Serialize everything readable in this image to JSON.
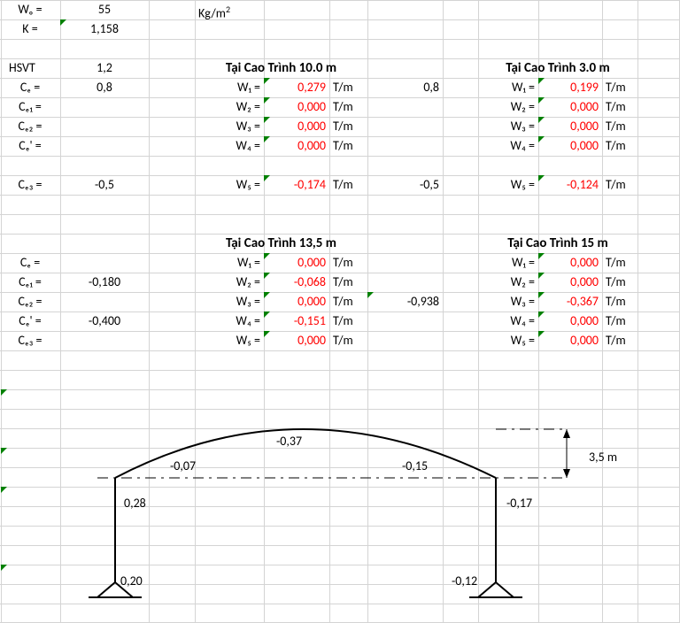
{
  "top_params": {
    "wo_label": "Wₒ =",
    "wo_value": "55",
    "wo_unit": "Kg/m",
    "wo_unit_sup": "2",
    "k_label": "K =",
    "k_value": "1,158",
    "hsvt_label": "HSVT",
    "hsvt_value": "1,2"
  },
  "ce_labels": {
    "ce": "Cₑ =",
    "ce1": "Cₑ₁ =",
    "ce2": "Cₑ₂ =",
    "cep": "Cₑ' =",
    "ce3": "Cₑ₃ ="
  },
  "section_10": {
    "title": "Tại Cao Trình 10.0 m",
    "ce_value": "0,8",
    "mid_val": "0,8",
    "ce3_value": "-0,5",
    "mid_val2": "-0,5",
    "w": [
      {
        "label": "W₁ =",
        "value": "0,279",
        "unit": "T/m"
      },
      {
        "label": "W₂ =",
        "value": "0,000",
        "unit": "T/m"
      },
      {
        "label": "W₃ =",
        "value": "0,000",
        "unit": "T/m"
      },
      {
        "label": "W₄ =",
        "value": "0,000",
        "unit": "T/m"
      },
      {
        "label": "W₅ =",
        "value": "-0,174",
        "unit": "T/m"
      }
    ]
  },
  "section_3": {
    "title": "Tại Cao Trình 3.0 m",
    "w": [
      {
        "label": "W₁ =",
        "value": "0,199",
        "unit": "T/m"
      },
      {
        "label": "W₂ =",
        "value": "0,000",
        "unit": "T/m"
      },
      {
        "label": "W₃ =",
        "value": "0,000",
        "unit": "T/m"
      },
      {
        "label": "W₄ =",
        "value": "0,000",
        "unit": "T/m"
      },
      {
        "label": "W₅ =",
        "value": "-0,124",
        "unit": "T/m"
      }
    ]
  },
  "section_135": {
    "title": "Tại Cao Trình 13,5 m",
    "ce1_value": "-0,180",
    "cep_value": "-0,400",
    "mid_val": "-0,938",
    "w": [
      {
        "label": "W₁ =",
        "value": "0,000",
        "unit": "T/m"
      },
      {
        "label": "W₂ =",
        "value": "-0,068",
        "unit": "T/m"
      },
      {
        "label": "W₃ =",
        "value": "0,000",
        "unit": "T/m"
      },
      {
        "label": "W₄ =",
        "value": "-0,151",
        "unit": "T/m"
      },
      {
        "label": "W₅ =",
        "value": "0,000",
        "unit": "T/m"
      }
    ]
  },
  "section_15": {
    "title": "Tại Cao Trình 15 m",
    "w": [
      {
        "label": "W₁ =",
        "value": "0,000",
        "unit": "T/m"
      },
      {
        "label": "W₂ =",
        "value": "0,000",
        "unit": "T/m"
      },
      {
        "label": "W₃ =",
        "value": "-0,367",
        "unit": "T/m"
      },
      {
        "label": "W₄ =",
        "value": "0,000",
        "unit": "T/m"
      },
      {
        "label": "W₅ =",
        "value": "0,000",
        "unit": "T/m"
      }
    ]
  },
  "diagram": {
    "v_top": "-0,37",
    "v_left_upper": "-0,07",
    "v_right_upper": "-0,15",
    "v_left_mid": "0,28",
    "v_right_mid": "-0,17",
    "v_left_base": "0,20",
    "v_right_base": "-0,12",
    "height_label": "3,5 m"
  }
}
